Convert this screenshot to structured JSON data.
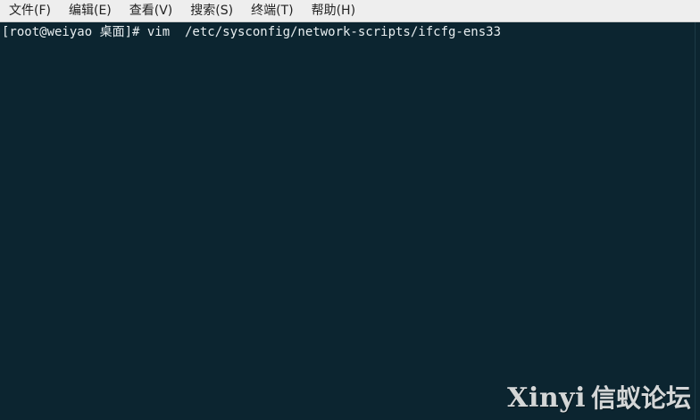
{
  "menubar": {
    "items": [
      {
        "label": "文件(F)"
      },
      {
        "label": "编辑(E)"
      },
      {
        "label": "查看(V)"
      },
      {
        "label": "搜索(S)"
      },
      {
        "label": "终端(T)"
      },
      {
        "label": "帮助(H)"
      }
    ]
  },
  "terminal": {
    "lines": [
      "[root@weiyao 桌面]# vim  /etc/sysconfig/network-scripts/ifcfg-ens33"
    ]
  },
  "watermark": {
    "brand": "Xinyi",
    "name": "信蚁论坛"
  },
  "colors": {
    "terminal_bg": "#0c2530",
    "terminal_fg": "#e8eef0",
    "menubar_bg": "#eeeeee"
  }
}
